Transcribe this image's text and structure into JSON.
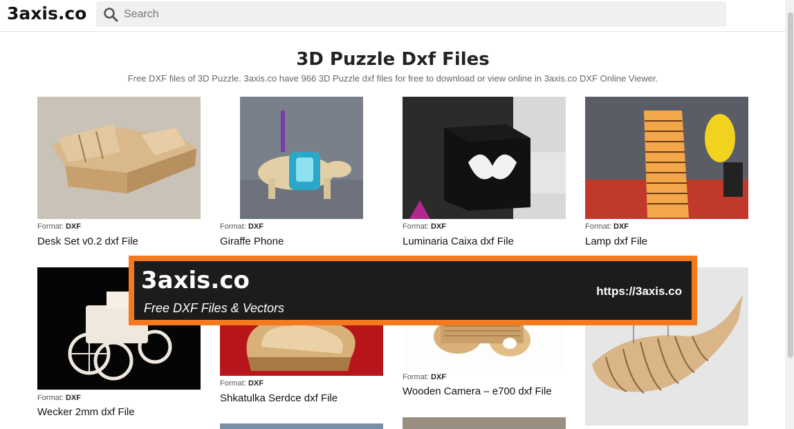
{
  "header": {
    "logo": "3axis.co",
    "search_placeholder": "Search"
  },
  "page": {
    "title": "3D Puzzle Dxf Files",
    "description": "Free DXF files of 3D Puzzle. 3axis.co have 966 3D Puzzle dxf files for free to download or view online in 3axis.co DXF Online Viewer."
  },
  "format_label": "Format:",
  "format_value": "DXF",
  "cards": [
    {
      "title": "Desk Set v0.2 dxf File",
      "format": "DXF"
    },
    {
      "title": "Giraffe Phone",
      "format": "DXF"
    },
    {
      "title": "Luminaria Caixa dxf File",
      "format": "DXF"
    },
    {
      "title": "Lamp dxf File",
      "format": "DXF"
    },
    {
      "title": "Wecker 2mm dxf File",
      "format": "DXF"
    },
    {
      "title": "Shkatulka Serdce dxf File",
      "format": "DXF"
    },
    {
      "title": "Wooden Camera – e700 dxf File",
      "format": "DXF"
    }
  ],
  "banner": {
    "logo": "3axis.co",
    "tagline": "Free DXF Files & Vectors",
    "url": "https://3axis.co"
  },
  "colors": {
    "banner_border": "#f47a1f",
    "banner_bg": "#1c1c1c",
    "search_bg": "#f0f0f2"
  }
}
